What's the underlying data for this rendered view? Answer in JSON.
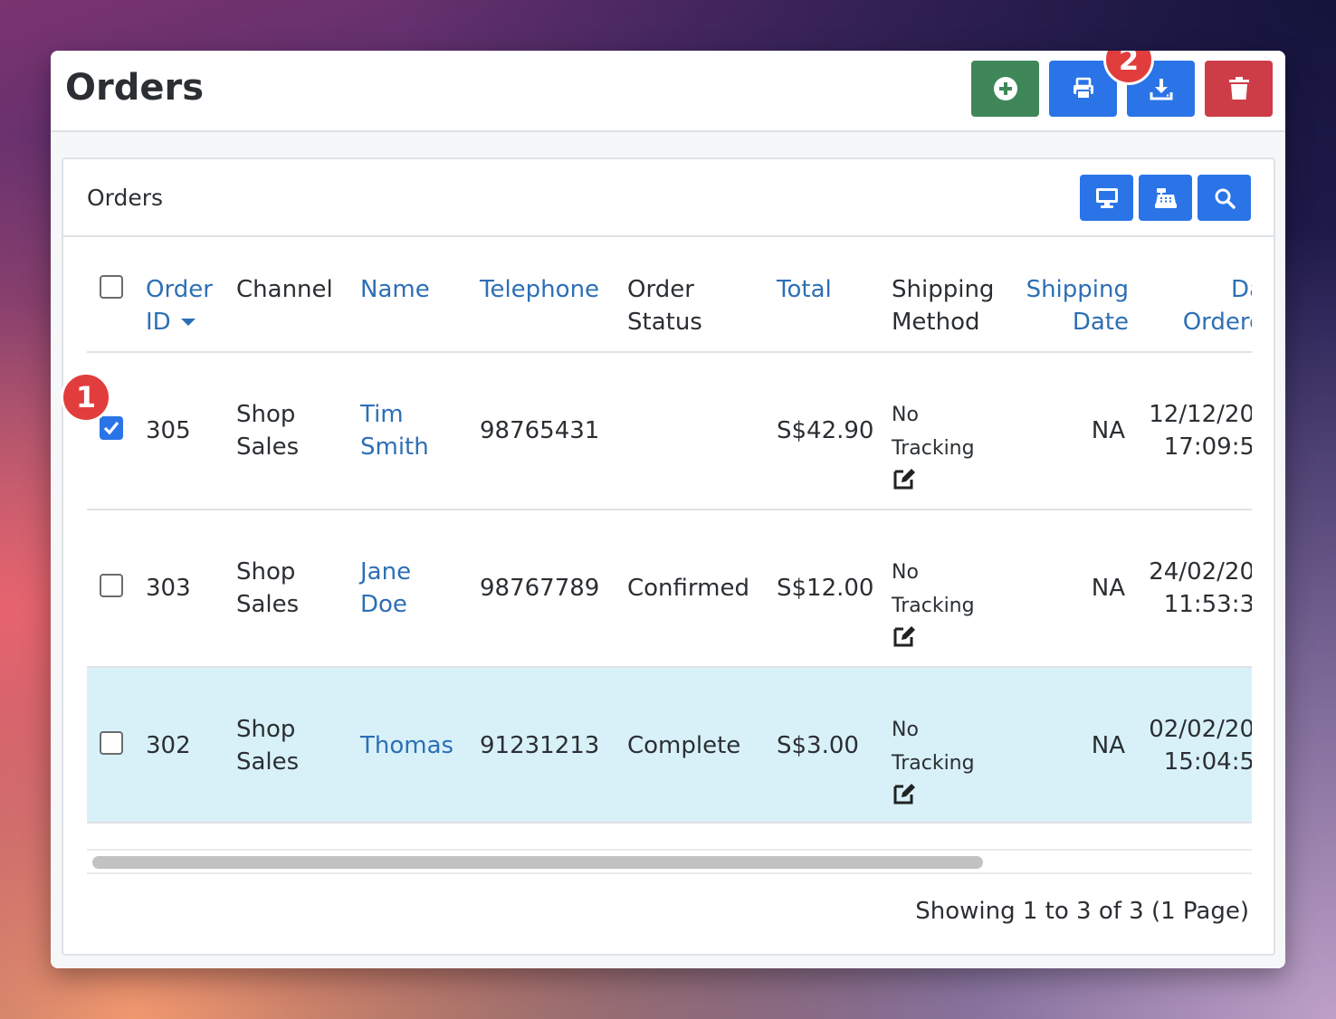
{
  "page": {
    "title": "Orders"
  },
  "toolbar": {
    "buttons": [
      {
        "name": "add",
        "icon": "plus-circle-icon",
        "color": "#3f8759"
      },
      {
        "name": "print",
        "icon": "printer-icon",
        "color": "#2a74e8"
      },
      {
        "name": "download",
        "icon": "download-icon",
        "color": "#2a74e8"
      },
      {
        "name": "delete",
        "icon": "trash-icon",
        "color": "#cd3d48"
      }
    ]
  },
  "badges": {
    "one": "1",
    "two": "2"
  },
  "card": {
    "title": "Orders",
    "header_buttons": [
      {
        "name": "display",
        "icon": "monitor-icon"
      },
      {
        "name": "cash-register",
        "icon": "cash-register-icon"
      },
      {
        "name": "search",
        "icon": "search-icon"
      }
    ]
  },
  "table": {
    "columns": {
      "order_id": {
        "line1": "Order",
        "line2": "ID"
      },
      "channel": "Channel",
      "name": "Name",
      "telephone": "Telephone",
      "order_status": {
        "line1": "Order",
        "line2": "Status"
      },
      "total": "Total",
      "shipping_method": {
        "line1": "Shipping",
        "line2": "Method"
      },
      "shipping_date": {
        "line1": "Shipping",
        "line2": "Date"
      },
      "date_ordered": {
        "line1": "Da",
        "line2": "Ordere"
      }
    },
    "rows": [
      {
        "checked": true,
        "order_id": "305",
        "channel": [
          "Shop",
          "Sales"
        ],
        "name": [
          "Tim",
          "Smith"
        ],
        "telephone": "98765431",
        "status": "",
        "total": "S$42.90",
        "shipping": [
          "No",
          "Tracking"
        ],
        "shipping_date": "NA",
        "date_ordered": [
          "12/12/20",
          "17:09:5"
        ]
      },
      {
        "checked": false,
        "order_id": "303",
        "channel": [
          "Shop",
          "Sales"
        ],
        "name": [
          "Jane",
          "Doe"
        ],
        "telephone": "98767789",
        "status": "Confirmed",
        "total": "S$12.00",
        "shipping": [
          "No",
          "Tracking"
        ],
        "shipping_date": "NA",
        "date_ordered": [
          "24/02/20",
          "11:53:3"
        ]
      },
      {
        "checked": false,
        "order_id": "302",
        "channel": [
          "Shop",
          "Sales"
        ],
        "name": [
          "Thomas",
          ""
        ],
        "telephone": "91231213",
        "status": "Complete",
        "total": "S$3.00",
        "shipping": [
          "No",
          "Tracking"
        ],
        "shipping_date": "NA",
        "date_ordered": [
          "02/02/20",
          "15:04:5"
        ]
      }
    ]
  },
  "footer": {
    "summary": "Showing 1 to 3 of 3 (1 Page)"
  },
  "colors": {
    "link": "#2d6fb5",
    "primary": "#2a74e8",
    "success": "#3f8759",
    "danger": "#cd3d48",
    "highlight_row": "#d8f1f9",
    "badge": "#e23d3d"
  }
}
